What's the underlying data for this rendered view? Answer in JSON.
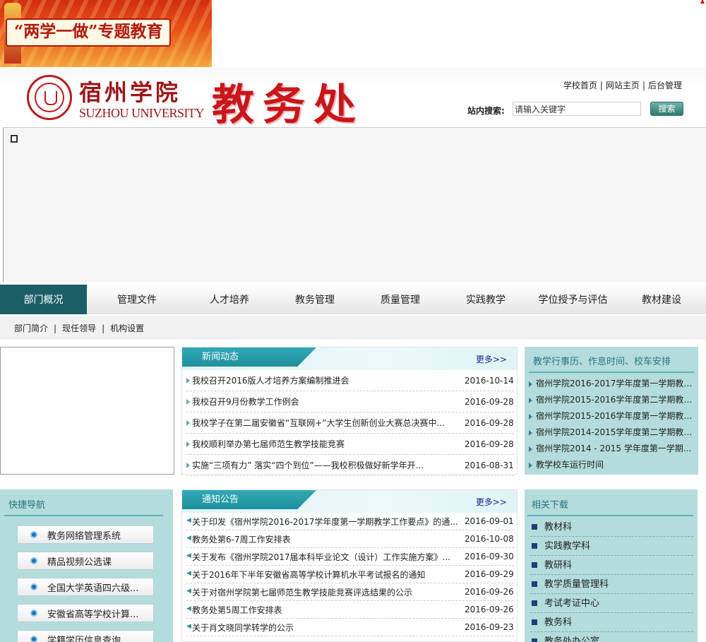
{
  "banner": {
    "text": "“两学一做”专题教育"
  },
  "header": {
    "university_cn": "宿州学院",
    "university_en": "SUZHOU UNIVERSITY",
    "department": "教务处",
    "links": [
      "学校首页",
      "网站主页",
      "后台管理"
    ],
    "search_label": "站内搜索:",
    "search_value": "请输入关键字",
    "search_button": "搜索"
  },
  "nav": {
    "items": [
      "部门概况",
      "管理文件",
      "人才培养",
      "教务管理",
      "质量管理",
      "实践教学",
      "学位授予与评估",
      "教材建设"
    ],
    "active_index": 0
  },
  "subnav": {
    "items": [
      "部门简介",
      "现任领导",
      "机构设置"
    ]
  },
  "news": {
    "title": "新闻动态",
    "more": "更多>>",
    "items": [
      {
        "title": "我校召开2016版人才培养方案编制推进会",
        "date": "2016-10-14"
      },
      {
        "title": "我校召开9月份教学工作例会",
        "date": "2016-09-28"
      },
      {
        "title": "我校学子在第二届安徽省“互联网+”大学生创新创业大赛总决赛中...",
        "date": "2016-09-28"
      },
      {
        "title": "我校顺利举办第七届师范生教学技能竞赛",
        "date": "2016-09-28"
      },
      {
        "title": "实施“三项有力” 落实“四个到位”——我校积极做好新学年开...",
        "date": "2016-08-31"
      }
    ]
  },
  "calendar": {
    "title": "教学行事历、作息时间、校车安排",
    "items": [
      "宿州学院2016-2017学年度第一学期教学...",
      "宿州学院2015-2016学年度第二学期教学...",
      "宿州学院2015-2016学年度第一学期教学...",
      "宿州学院2014-2015学年度第二学期教学...",
      "宿州学院2014 - 2015 学年度第一学期...",
      "教学校车运行时间"
    ]
  },
  "quick_nav": {
    "title": "快捷导航",
    "items": [
      "教务网络管理系统",
      "精品视频公选课",
      "全国大学英语四六级...",
      "安徽省高等学校计算...",
      "学籍学历信息查询"
    ]
  },
  "notices": {
    "title": "通知公告",
    "more": "更多>>",
    "items": [
      {
        "title": "关于印发《宿州学院2016-2017学年度第一学期教学工作要点》的通...",
        "date": "2016-09-01"
      },
      {
        "title": "教务处第6-7周工作安排表",
        "date": "2016-10-08"
      },
      {
        "title": "关于发布《宿州学院2017届本科毕业论文（设计）工作实施方案》...",
        "date": "2016-09-30"
      },
      {
        "title": "关于2016年下半年安徽省高等学校计算机水平考试报名的通知",
        "date": "2016-09-29"
      },
      {
        "title": "关于对宿州学院第七届师范生教学技能竞赛评选结果的公示",
        "date": "2016-09-26"
      },
      {
        "title": "教务处第5周工作安排表",
        "date": "2016-09-26"
      },
      {
        "title": "关于肖文晓同学转学的公示",
        "date": "2016-09-23"
      }
    ]
  },
  "downloads": {
    "title": "相关下载",
    "items": [
      "教材科",
      "实践教学科",
      "教研科",
      "教学质量管理科",
      "考试考证中心",
      "教务科",
      "教务处办公室"
    ]
  },
  "colors": {
    "nav_active": "#1a5e66",
    "panel_tab": "#1f8f9c",
    "sidebar_bg": "#b4dcdc",
    "title_red": "#c8161b"
  }
}
